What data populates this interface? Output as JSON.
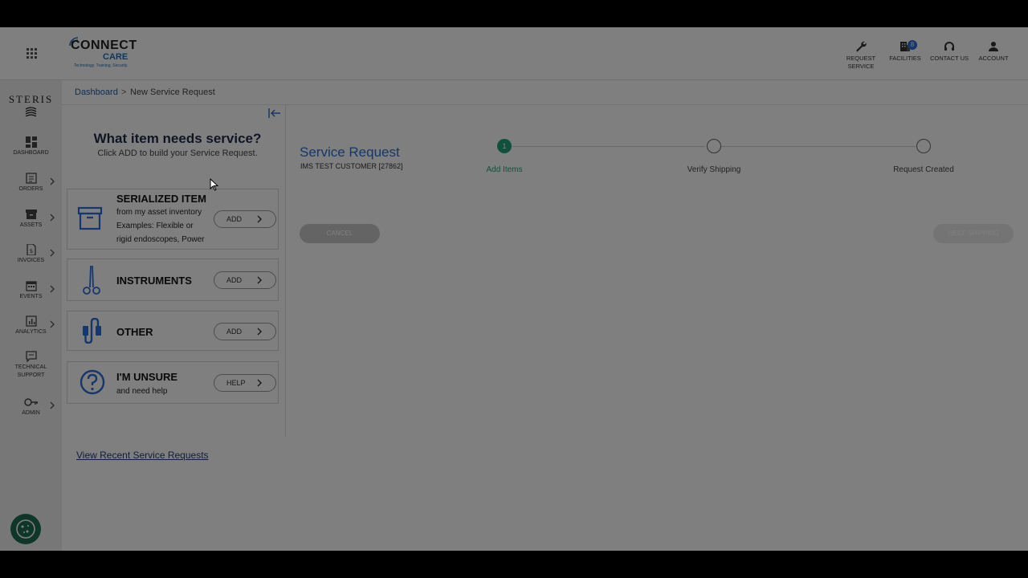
{
  "header": {
    "logo": {
      "text1": "CONNECT",
      "text2": "CARE",
      "tagline": "Technology. Training. Security."
    },
    "nav": [
      {
        "label": "REQUEST SERVICE",
        "icon": "wrench-icon"
      },
      {
        "label": "FACILITIES",
        "icon": "building-icon",
        "badge": "8"
      },
      {
        "label": "CONTACT US",
        "icon": "headset-icon"
      },
      {
        "label": "ACCOUNT",
        "icon": "person-icon"
      }
    ]
  },
  "sidebar": {
    "brand": "STERIS",
    "items": [
      {
        "label": "DASHBOARD",
        "icon": "dashboard-icon"
      },
      {
        "label": "ORDERS",
        "icon": "orders-icon"
      },
      {
        "label": "ASSETS",
        "icon": "box-icon"
      },
      {
        "label": "INVOICES",
        "icon": "invoice-icon"
      },
      {
        "label": "EVENTS",
        "icon": "calendar-icon"
      },
      {
        "label": "ANALYTICS",
        "icon": "chart-icon"
      },
      {
        "label": "TECHNICAL SUPPORT",
        "icon": "chat-icon"
      },
      {
        "label": "ADMIN",
        "icon": "key-icon"
      }
    ]
  },
  "breadcrumb": {
    "home": "Dashboard",
    "separator": ">",
    "current": "New Service Request"
  },
  "panel": {
    "title": "What item needs service?",
    "subtitle": "Click ADD to build your Service Request.",
    "cards": [
      {
        "title": "SERIALIZED ITEM",
        "line1": "from my asset inventory",
        "line2": "Examples: Flexible or",
        "line3": "rigid endoscopes, Power",
        "button": "ADD",
        "icon": "archive-box-icon"
      },
      {
        "title": "INSTRUMENTS",
        "button": "ADD",
        "icon": "scissors-icon"
      },
      {
        "title": "OTHER",
        "button": "ADD",
        "icon": "plug-icon"
      },
      {
        "title": "I'M UNSURE",
        "subtitle": "and need help",
        "button": "HELP",
        "icon": "question-icon"
      }
    ],
    "recent_link": "View Recent Service Requests"
  },
  "main": {
    "title": "Service Request",
    "customer": "IMS TEST CUSTOMER [27862]",
    "steps": [
      {
        "number": "1",
        "label": "Add Items"
      },
      {
        "label": "Verify Shipping"
      },
      {
        "label": "Request Created"
      }
    ],
    "cancel_label": "CANCEL",
    "next_label": "NEXT: SHIPPING"
  },
  "colors": {
    "accent": "#2a6fd6",
    "step_active": "#1fa37a",
    "brand_navy": "#1c2a4a"
  }
}
